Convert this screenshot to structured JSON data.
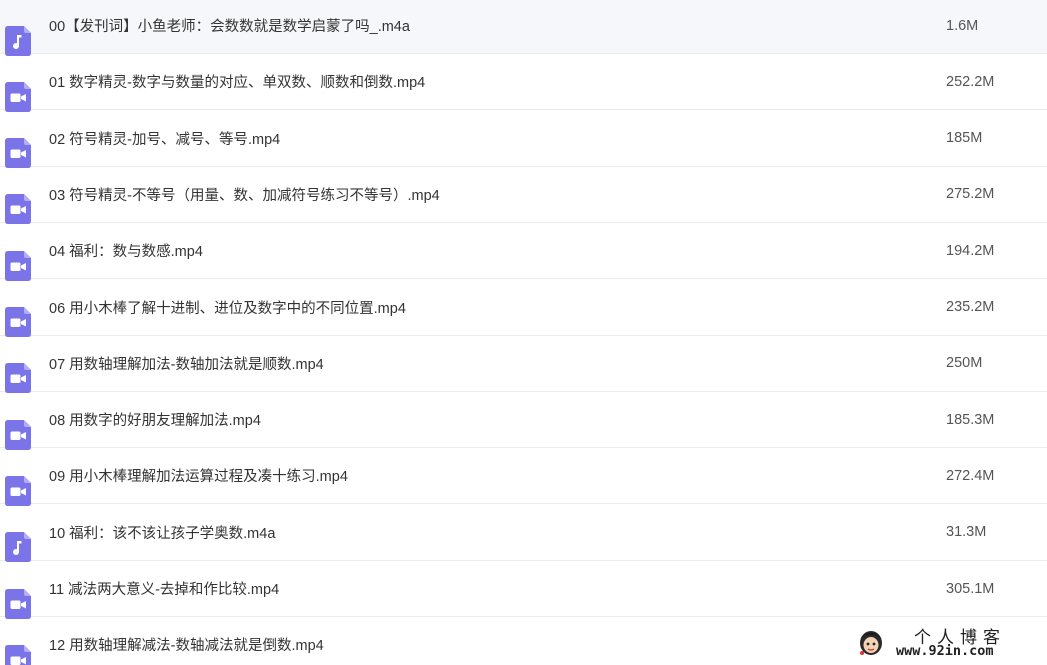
{
  "colors": {
    "icon_purple": "#7b74e8",
    "divider": "#ececec",
    "text": "#333333"
  },
  "files": [
    {
      "name": "00【发刊词】小鱼老师：会数数就是数学启蒙了吗_.m4a",
      "size": "1.6M",
      "icon": "music-note-icon"
    },
    {
      "name": "01 数字精灵-数字与数量的对应、单双数、顺数和倒数.mp4",
      "size": "252.2M",
      "icon": "video-camera-icon"
    },
    {
      "name": "02 符号精灵-加号、减号、等号.mp4",
      "size": "185M",
      "icon": "video-camera-icon"
    },
    {
      "name": "03 符号精灵-不等号（用量、数、加减符号练习不等号）.mp4",
      "size": "275.2M",
      "icon": "video-camera-icon"
    },
    {
      "name": "04 福利：数与数感.mp4",
      "size": "194.2M",
      "icon": "video-camera-icon"
    },
    {
      "name": "06 用小木棒了解十进制、进位及数字中的不同位置.mp4",
      "size": "235.2M",
      "icon": "video-camera-icon"
    },
    {
      "name": "07 用数轴理解加法-数轴加法就是顺数.mp4",
      "size": "250M",
      "icon": "video-camera-icon"
    },
    {
      "name": "08 用数字的好朋友理解加法.mp4",
      "size": "185.3M",
      "icon": "video-camera-icon"
    },
    {
      "name": "09 用小木棒理解加法运算过程及凑十练习.mp4",
      "size": "272.4M",
      "icon": "video-camera-icon"
    },
    {
      "name": "10 福利：该不该让孩子学奥数.m4a",
      "size": "31.3M",
      "icon": "music-note-icon"
    },
    {
      "name": "11 减法两大意义-去掉和作比较.mp4",
      "size": "305.1M",
      "icon": "video-camera-icon"
    },
    {
      "name": "12 用数轴理解减法-数轴减法就是倒数.mp4",
      "size": "",
      "icon": "video-camera-icon"
    }
  ],
  "watermark": {
    "title": "个人博客",
    "url": "www.92in.com"
  }
}
